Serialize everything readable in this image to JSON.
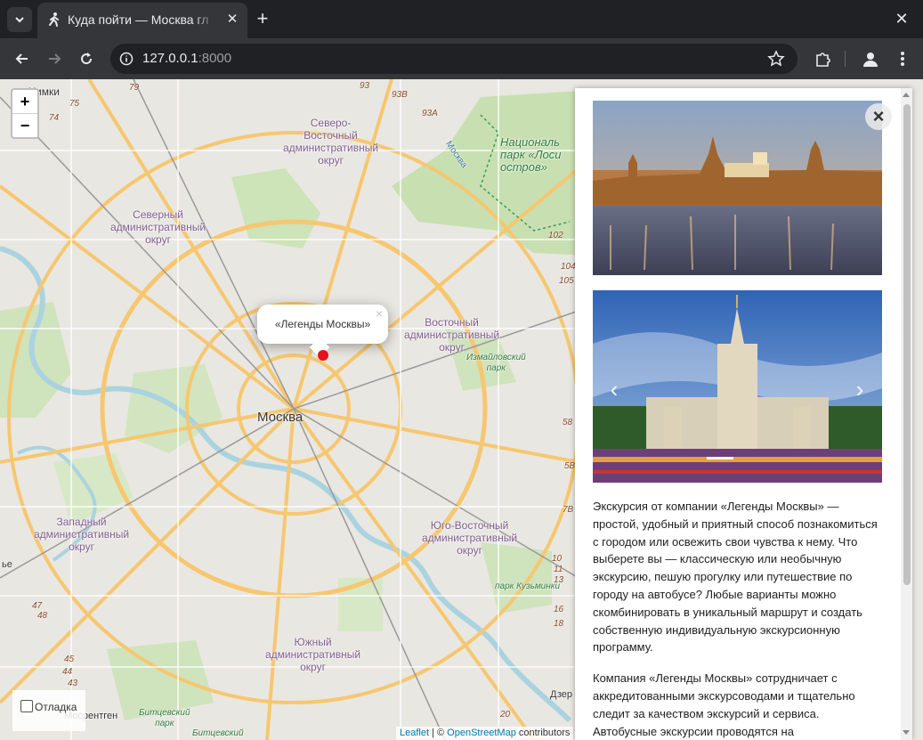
{
  "browser": {
    "tab_title": "Куда пойти — Москва гл",
    "url_host": "127.0.0.1",
    "url_port": ":8000"
  },
  "map": {
    "zoom_in": "+",
    "zoom_out": "−",
    "city_label": "Москва",
    "labels": {
      "khimki": "Химки",
      "ne_okrug": "Северо-\nВосточный\nадминистративный\nокруг",
      "n_okrug": "Северный\nадминистративный\nокруг",
      "e_okrug": "Восточный\nадминистративный\nокруг",
      "w_okrug": "Западный\nадминистративный\nокруг",
      "se_okrug": "Юго-Восточный\nадминистративный\nокруг",
      "s_okrug": "Южный\nадминистративный\nокруг",
      "national_park": "Националь\nпарк «Лоси\nостров»",
      "izmailovo": "Измайловский\nпарк",
      "kuzminki": "парк Кузьминки",
      "bitsevsky": "Битцевский\nпарк",
      "bitsevsky2": "Битцевский",
      "mosrentgen": "Мосрентген",
      "moskva_river": "Москва",
      "dzer": "Дзер",
      "ye": "ье"
    },
    "road_numbers": [
      "79",
      "75",
      "74",
      "93В",
      "93А",
      "93",
      "102",
      "104",
      "105",
      "58",
      "7В",
      "5В",
      "20",
      "10",
      "11",
      "13",
      "16",
      "18",
      "47",
      "48",
      "45",
      "44",
      "43",
      "42"
    ],
    "popup_text": "«Легенды Москвы»",
    "popup_close": "×",
    "debug_label": "Отладка",
    "attribution": {
      "leaflet": "Leaflet",
      "sep": " | © ",
      "osm": "OpenStreetMap",
      "contrib": " contributors"
    }
  },
  "panel": {
    "close": "×",
    "prev": "‹",
    "next": "›",
    "paragraphs": [
      "Экскурсия от компании «Легенды Москвы» — простой, удобный и приятный способ познакомиться с городом или освежить свои чувства к нему. Что выберете вы — классическую или необычную экскурсию, пешую прогулку или путешествие по городу на автобусе? Любые варианты можно скомбинировать в уникальный маршрут и создать собственную индивидуальную экскурсионную программу.",
      "Компания «Легенды Москвы» сотрудничает с аккредитованными экскурсоводами и тщательно следит за качеством экскурсий и сервиса. Автобусные экскурсии проводятся на"
    ]
  },
  "colors": {
    "marker": "#e3121b",
    "map_bg": "#e9e7e1",
    "park": "#c8dfb2",
    "water": "#aad3df",
    "road_major": "#f6c770",
    "road_minor": "#ffffff"
  }
}
